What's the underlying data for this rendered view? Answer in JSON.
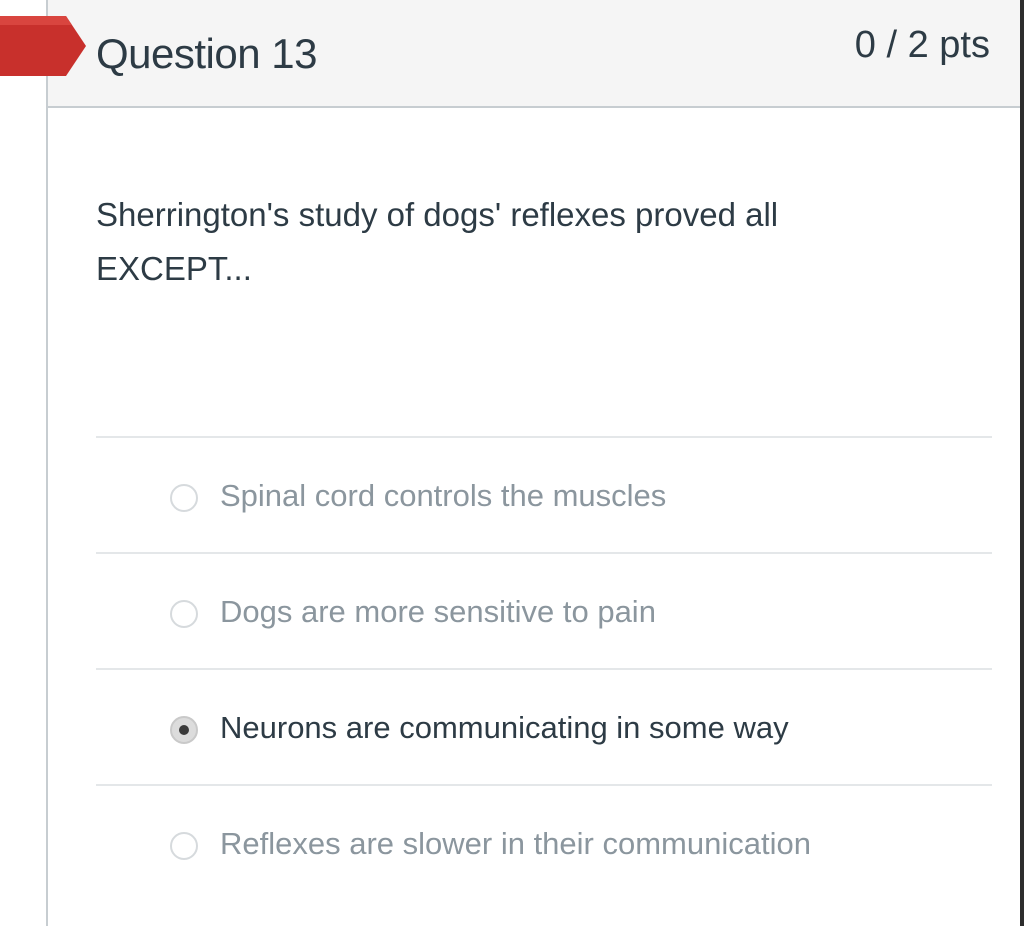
{
  "question": {
    "title": "Question 13",
    "points": "0 / 2 pts",
    "text": "Sherrington's study of dogs' reflexes proved all EXCEPT...",
    "status_flag_color": "#c8302c"
  },
  "answers": [
    {
      "label": "Spinal cord controls the muscles",
      "selected": false
    },
    {
      "label": "Dogs are more sensitive to pain",
      "selected": false
    },
    {
      "label": "Neurons are communicating in some way",
      "selected": true
    },
    {
      "label": "Reflexes are slower in their communication",
      "selected": false
    }
  ]
}
